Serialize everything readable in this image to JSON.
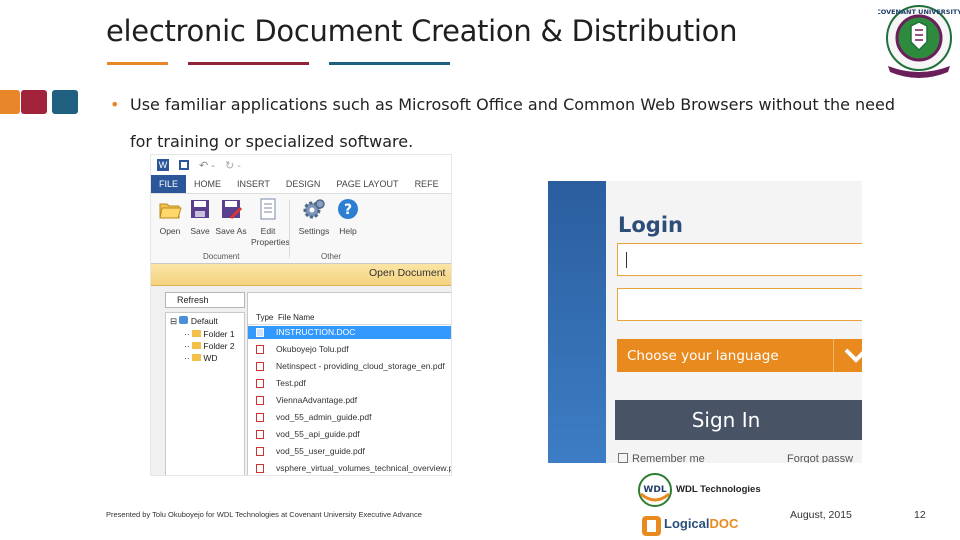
{
  "slide": {
    "title": "electronic Document Creation & Distribution",
    "bullet": "Use familiar applications such as Microsoft Office and Common Web Browsers without the need for training or specialized software.",
    "footer": "Presented by Tolu Okuboyejo for WDL Technologies at Covenant University Executive Advance",
    "date": "August, 2015",
    "page_number": "12",
    "logo_text": "COVENANT UNIVERSITY"
  },
  "colors": {
    "orange": "#e8862a",
    "maroon": "#8f2438",
    "teal": "#1f5f80",
    "word_blue": "#2b579a",
    "login_orange": "#e98a1f",
    "login_dark": "#485365"
  },
  "word": {
    "tabs": [
      "FILE",
      "HOME",
      "INSERT",
      "DESIGN",
      "PAGE LAYOUT",
      "REFE"
    ],
    "ribbon_buttons": [
      {
        "label": "Open",
        "icon": "folder-open-icon"
      },
      {
        "label": "Save",
        "icon": "save-icon"
      },
      {
        "label": "Save As",
        "icon": "save-as-icon"
      },
      {
        "label": "Edit Properties",
        "icon": "properties-icon"
      },
      {
        "label": "Settings",
        "icon": "gear-icon"
      },
      {
        "label": "Help",
        "icon": "help-icon"
      }
    ],
    "groups": [
      "Document",
      "Other"
    ],
    "dialog_title": "Open Document",
    "refresh": "Refresh",
    "tree": [
      "Default",
      "Folder 1",
      "Folder 2",
      "WD"
    ],
    "file_header": {
      "type": "Type",
      "name": "File Name"
    },
    "files": [
      "INSTRUCTION.DOC",
      "Okuboyejo Tolu.pdf",
      "Netinspect - providing_cloud_storage_en.pdf",
      "Test.pdf",
      "ViennaAdvantage.pdf",
      "vod_55_admin_guide.pdf",
      "vod_55_api_guide.pdf",
      "vod_55_user_guide.pdf",
      "vsphere_virtual_volumes_technical_overview.pdf"
    ]
  },
  "login": {
    "title": "Login",
    "language_placeholder": "Choose your language",
    "sign_in": "Sign In",
    "remember_me": "Remember me",
    "forgot": "Forgot passw"
  },
  "brands": {
    "wdl": "WDL Technologies",
    "logicaldoc_a": "Logical",
    "logicaldoc_b": "DOC"
  }
}
